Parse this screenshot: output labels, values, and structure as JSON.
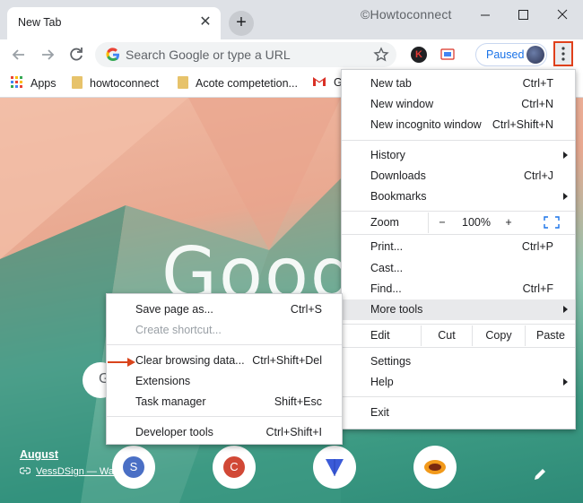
{
  "window": {
    "tab_title": "New Tab",
    "watermark": "©Howtoconnect",
    "new_tab_symbol": "+",
    "close_symbol": "✕"
  },
  "toolbar": {
    "omnibox_placeholder": "Search Google or type a URL",
    "profile_status": "Paused",
    "extension_k_letter": "K"
  },
  "bookmarks": [
    {
      "label": "Apps",
      "icon": "apps-grid-icon"
    },
    {
      "label": "howtoconnect",
      "icon": "folder-icon"
    },
    {
      "label": "Acote competetion...",
      "icon": "folder-icon"
    },
    {
      "label": "G",
      "icon": "gmail-icon"
    }
  ],
  "ntp": {
    "logo_partial": "Goog",
    "search_letter": "G",
    "credit_title": "August",
    "credit_link": "VessDSign — Wa",
    "tiles": [
      {
        "letter": "S",
        "color": "#4a6fc5"
      },
      {
        "letter": "C",
        "color": "#d14836"
      },
      {
        "letter": "",
        "color": "#3b5bd8"
      },
      {
        "letter": "",
        "color": "#f29a1b"
      }
    ]
  },
  "main_menu": {
    "new_tab": {
      "label": "New tab",
      "shortcut": "Ctrl+T"
    },
    "new_window": {
      "label": "New window",
      "shortcut": "Ctrl+N"
    },
    "new_incognito": {
      "label": "New incognito window",
      "shortcut": "Ctrl+Shift+N"
    },
    "history": {
      "label": "History"
    },
    "downloads": {
      "label": "Downloads",
      "shortcut": "Ctrl+J"
    },
    "bookmarks": {
      "label": "Bookmarks"
    },
    "zoom": {
      "label": "Zoom",
      "minus": "−",
      "value": "100%",
      "plus": "+"
    },
    "print": {
      "label": "Print...",
      "shortcut": "Ctrl+P"
    },
    "cast": {
      "label": "Cast..."
    },
    "find": {
      "label": "Find...",
      "shortcut": "Ctrl+F"
    },
    "more_tools": {
      "label": "More tools"
    },
    "edit": {
      "label": "Edit",
      "cut": "Cut",
      "copy": "Copy",
      "paste": "Paste"
    },
    "settings": {
      "label": "Settings"
    },
    "help": {
      "label": "Help"
    },
    "exit": {
      "label": "Exit"
    }
  },
  "sub_menu": {
    "save_page": {
      "label": "Save page as...",
      "shortcut": "Ctrl+S"
    },
    "create_shortcut": {
      "label": "Create shortcut..."
    },
    "clear_browsing": {
      "label": "Clear browsing data...",
      "shortcut": "Ctrl+Shift+Del"
    },
    "extensions": {
      "label": "Extensions"
    },
    "task_manager": {
      "label": "Task manager",
      "shortcut": "Shift+Esc"
    },
    "developer_tools": {
      "label": "Developer tools",
      "shortcut": "Ctrl+Shift+I"
    }
  },
  "colors": {
    "accent_blue": "#1a73e8",
    "highlight_border": "#e0401b",
    "annotation_arrow": "#d9441c"
  }
}
